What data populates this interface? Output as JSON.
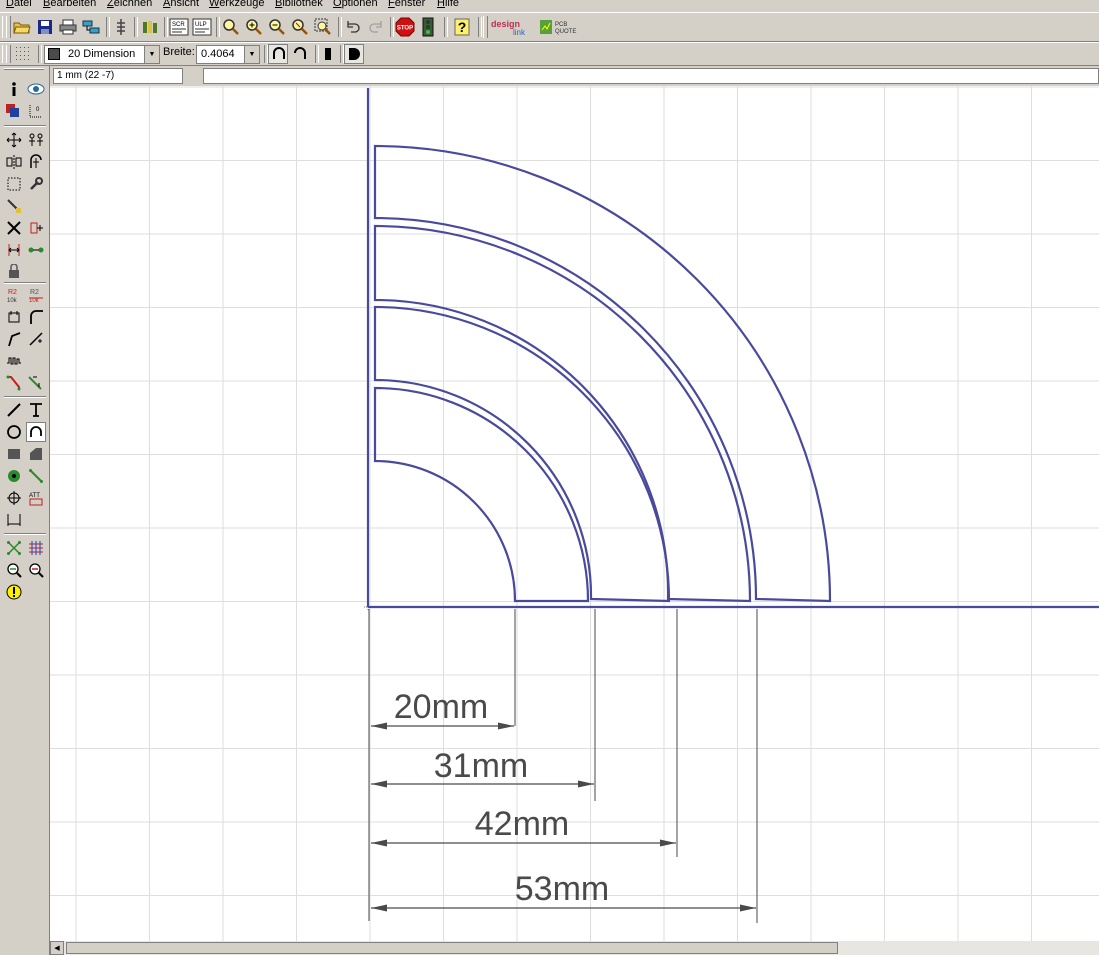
{
  "menu": [
    "Datei",
    "Bearbeiten",
    "Zeichnen",
    "Ansicht",
    "Werkzeuge",
    "Bibliothek",
    "Optionen",
    "Fenster",
    "Hilfe"
  ],
  "toolbar": {
    "logo_design": "design",
    "logo_link": "link",
    "pcb_quote_top": "PCB",
    "pcb_quote_bottom": "QUOTE",
    "stop_label": "STOP",
    "scr_label": "SCR",
    "ulp_label": "ULP"
  },
  "param_bar": {
    "layer_value": "20 Dimension",
    "width_label": "Breite:",
    "width_value": "0.4064"
  },
  "coordinate_display": "1 mm (22 -7)",
  "dimensions": [
    "20mm",
    "31mm",
    "42mm",
    "53mm"
  ],
  "colors": {
    "wire": "#4a4a9c",
    "grid": "#dedede",
    "dimension": "#4a4a4a",
    "background": "#d4d0c8"
  },
  "palette_icons": [
    "info-icon",
    "show-icon",
    "display-icon",
    "mark-icon",
    "move-icon",
    "copy-icon",
    "mirror-icon",
    "rotate-icon",
    "group-icon",
    "change-icon",
    "paste-icon",
    "delete-icon",
    "add-icon",
    "pinswap-icon",
    "gateswap-icon",
    "replace-icon",
    "name-icon",
    "value-icon",
    "smash-icon",
    "miter-icon",
    "split-icon",
    "optimize-icon",
    "meander-icon",
    "route-icon",
    "ripup-icon",
    "wire-icon",
    "text-icon",
    "circle-icon",
    "arc-icon",
    "rect-icon",
    "polygon-icon",
    "via-icon",
    "signal-icon",
    "hole-icon",
    "attribute-icon",
    "dimension-icon",
    "ratsnest-icon",
    "autorouter-icon",
    "drc-icon",
    "errors-icon",
    "erc-icon"
  ]
}
